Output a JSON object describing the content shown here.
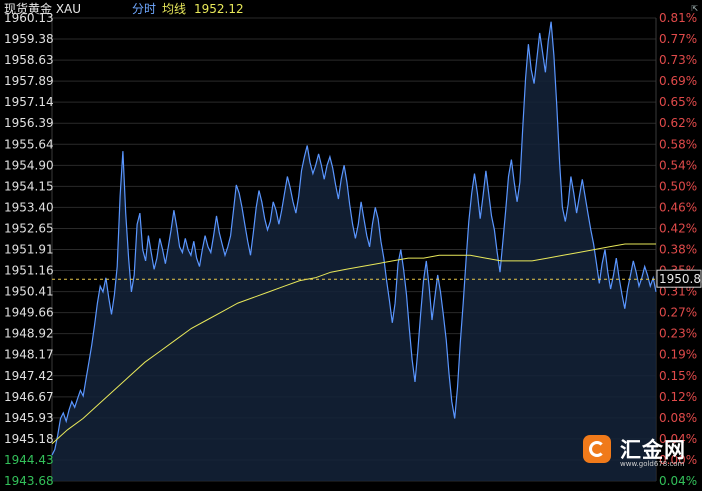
{
  "header": {
    "instrument": "现货黄金 XAU",
    "mode": "分时",
    "ma_label": "均线",
    "ma_value": "1952.12"
  },
  "corner_button": {
    "icon": "expand-icon",
    "glyph": "⇱"
  },
  "chart_data": {
    "type": "line",
    "title": "现货黄金 XAU",
    "grid": true,
    "ylim": [
      1943.68,
      1960.13
    ],
    "y_ticks_left": [
      "1960.13",
      "1959.38",
      "1958.63",
      "1957.89",
      "1957.14",
      "1956.39",
      "1955.64",
      "1954.90",
      "1954.15",
      "1953.40",
      "1952.65",
      "1951.91",
      "1951.16",
      "1950.41",
      "1949.66",
      "1948.92",
      "1948.17",
      "1947.42",
      "1946.67",
      "1945.93",
      "1945.18",
      "1944.43",
      "1943.68"
    ],
    "y_ticks_right": [
      "0.81%",
      "0.77%",
      "0.73%",
      "0.69%",
      "0.65%",
      "0.62%",
      "0.58%",
      "0.54%",
      "0.50%",
      "0.46%",
      "0.42%",
      "0.38%",
      "0.35%",
      "0.31%",
      "0.27%",
      "0.23%",
      "0.19%",
      "0.15%",
      "0.12%",
      "0.08%",
      "0.04%",
      "0.00%",
      "0.04%"
    ],
    "reference_price": 1950.85,
    "reference_label": "1950.85",
    "colors": {
      "price": "#5a96ff",
      "average": "#e8e85a",
      "up": "#e04a4a",
      "down": "#33c05a",
      "grid": "#2a2a2a"
    },
    "series": [
      {
        "name": "price",
        "values": [
          1944.6,
          1944.8,
          1945.3,
          1945.9,
          1946.1,
          1945.8,
          1946.2,
          1946.5,
          1946.3,
          1946.6,
          1946.9,
          1946.7,
          1947.3,
          1947.9,
          1948.5,
          1949.2,
          1950.0,
          1950.6,
          1950.4,
          1950.9,
          1950.2,
          1949.6,
          1950.3,
          1951.3,
          1953.8,
          1955.4,
          1953.2,
          1951.6,
          1950.4,
          1951.0,
          1952.8,
          1953.2,
          1951.9,
          1951.5,
          1952.4,
          1951.8,
          1951.2,
          1951.6,
          1952.3,
          1951.9,
          1951.4,
          1952.0,
          1952.6,
          1953.3,
          1952.7,
          1952.0,
          1951.8,
          1952.3,
          1951.9,
          1951.7,
          1952.2,
          1951.6,
          1951.3,
          1951.9,
          1952.4,
          1952.0,
          1951.8,
          1952.4,
          1953.1,
          1952.5,
          1952.1,
          1951.7,
          1952.0,
          1952.4,
          1953.3,
          1954.2,
          1953.9,
          1953.4,
          1952.8,
          1952.2,
          1951.7,
          1952.5,
          1953.4,
          1954.0,
          1953.6,
          1953.0,
          1952.6,
          1952.9,
          1953.6,
          1953.3,
          1952.8,
          1953.3,
          1953.9,
          1954.5,
          1954.1,
          1953.6,
          1953.2,
          1953.8,
          1954.7,
          1955.2,
          1955.6,
          1955.0,
          1954.6,
          1954.9,
          1955.3,
          1954.9,
          1954.4,
          1954.9,
          1955.2,
          1954.8,
          1954.2,
          1953.7,
          1954.4,
          1954.9,
          1954.3,
          1953.5,
          1952.8,
          1952.3,
          1952.8,
          1953.6,
          1953.0,
          1952.4,
          1952.0,
          1952.8,
          1953.4,
          1953.0,
          1952.2,
          1951.6,
          1950.8,
          1950.1,
          1949.3,
          1950.0,
          1951.4,
          1951.9,
          1951.2,
          1950.3,
          1949.1,
          1948.0,
          1947.2,
          1948.3,
          1949.6,
          1950.8,
          1951.5,
          1950.6,
          1949.4,
          1950.2,
          1951.0,
          1950.4,
          1949.6,
          1948.7,
          1947.5,
          1946.5,
          1945.9,
          1947.0,
          1948.6,
          1950.0,
          1951.5,
          1952.9,
          1953.9,
          1954.6,
          1953.9,
          1953.0,
          1953.8,
          1954.7,
          1953.9,
          1953.1,
          1952.6,
          1951.8,
          1951.1,
          1952.2,
          1953.3,
          1954.5,
          1955.1,
          1954.3,
          1953.6,
          1954.3,
          1956.2,
          1958.0,
          1959.2,
          1958.3,
          1957.8,
          1958.7,
          1959.6,
          1958.9,
          1958.2,
          1959.3,
          1960.0,
          1958.8,
          1957.0,
          1955.0,
          1953.4,
          1952.9,
          1953.5,
          1954.5,
          1953.9,
          1953.2,
          1953.8,
          1954.4,
          1953.8,
          1953.2,
          1952.6,
          1952.1,
          1951.4,
          1950.7,
          1951.4,
          1951.9,
          1951.1,
          1950.5,
          1951.0,
          1951.6,
          1950.9,
          1950.3,
          1949.8,
          1950.5,
          1951.0,
          1951.5,
          1951.1,
          1950.6,
          1950.9,
          1951.3,
          1951.0,
          1950.6,
          1950.9,
          1950.4
        ]
      },
      {
        "name": "average",
        "values": [
          1945.0,
          1945.5,
          1945.9,
          1946.4,
          1946.9,
          1947.4,
          1947.9,
          1948.3,
          1948.7,
          1949.1,
          1949.4,
          1949.7,
          1950.0,
          1950.2,
          1950.4,
          1950.6,
          1950.8,
          1950.9,
          1951.1,
          1951.2,
          1951.3,
          1951.4,
          1951.5,
          1951.6,
          1951.6,
          1951.7,
          1951.7,
          1951.7,
          1951.6,
          1951.5,
          1951.5,
          1951.5,
          1951.6,
          1951.7,
          1951.8,
          1951.9,
          1952.0,
          1952.1,
          1952.1,
          1952.1
        ]
      }
    ]
  },
  "logo": {
    "name": "汇金网",
    "url": "www.gold678.com"
  }
}
